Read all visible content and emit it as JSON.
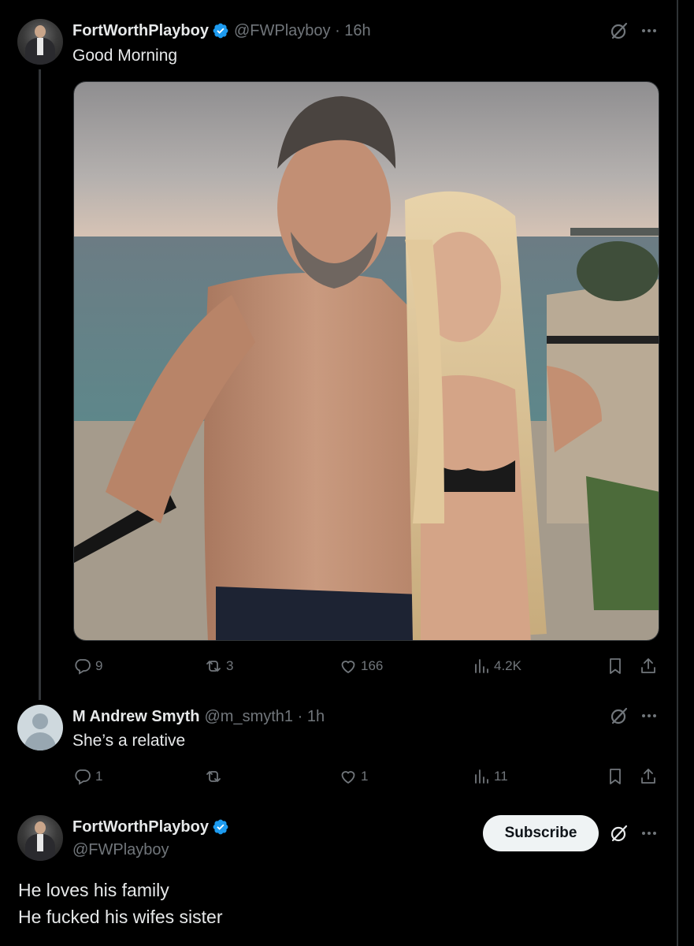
{
  "tweet1": {
    "name": "FortWorthPlayboy",
    "handle": "@FWPlayboy · 16h",
    "text": "Good Morning",
    "media_icon": "photo",
    "stats": {
      "replies": "9",
      "reposts": "3",
      "likes": "166",
      "views": "4.2K"
    }
  },
  "reply": {
    "name": "M Andrew Smyth",
    "handle": "@m_smyth1 · 1h",
    "text": "She’s a relative",
    "stats": {
      "replies": "1",
      "reposts": "",
      "likes": "1",
      "views": "11"
    }
  },
  "tweet2": {
    "name": "FortWorthPlayboy",
    "handle": "@FWPlayboy",
    "subscribe_label": "Subscribe",
    "text_line1": "He loves his family",
    "text_line2": "He fucked his wifes sister"
  },
  "colors": {
    "background": "#000000",
    "text": "#e7e9ea",
    "secondary": "#71767b",
    "verified": "#1d9bf0",
    "button_bg": "#eff3f4"
  },
  "icons": [
    "grok-icon",
    "more-icon",
    "reply-icon",
    "repost-icon",
    "like-icon",
    "views-icon",
    "bookmark-icon",
    "share-icon",
    "verified-badge-icon"
  ]
}
